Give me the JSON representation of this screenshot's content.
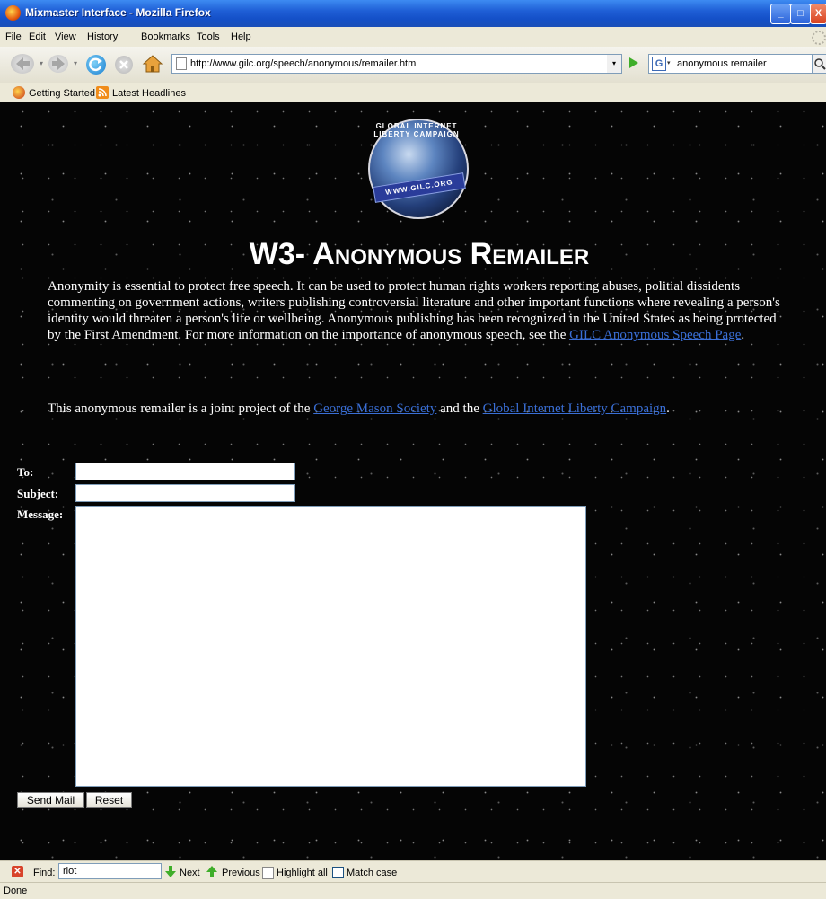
{
  "window": {
    "title": "Mixmaster Interface - Mozilla Firefox",
    "minimize": "_",
    "maximize": "□",
    "close": "X"
  },
  "menu": [
    "File",
    "Edit",
    "View",
    "History",
    "Bookmarks",
    "Tools",
    "Help"
  ],
  "nav": {
    "url": "http://www.gilc.org/speech/anonymous/remailer.html",
    "search_engine_icon": "G",
    "search_value": "anonymous remailer"
  },
  "bookmarks": [
    {
      "label": "Getting Started",
      "icon": "firefox-icon"
    },
    {
      "label": "Latest Headlines",
      "icon": "rss-icon"
    }
  ],
  "logo": {
    "ring_text": "GLOBAL INTERNET LIBERTY CAMPAIGN",
    "ribbon_text": "WWW.GILC.ORG"
  },
  "page": {
    "heading": "W3- Anonymous Remailer",
    "para1_text": "Anonymity is essential to protect free speech. It can be used to protect human rights workers reporting abuses, politial dissidents commenting on government actions, writers publishing controversial literature and other important functions where revealing a person's identity would threaten a person's life or wellbeing. Anonymous publishing has been recognized in the United States as being protected by the First Amendment. For more information on the importance of anonymous speech, see the ",
    "para1_link": "GILC Anonymous Speech Page",
    "para1_end": ".",
    "para2_text": "This anonymous remailer is a joint project of the ",
    "para2_link1": "George Mason Society",
    "para2_mid": " and the ",
    "para2_link2": "Global Internet Liberty Campaign",
    "para2_end": "."
  },
  "form": {
    "to_label": "To:",
    "subject_label": "Subject:",
    "message_label": "Message:",
    "to_value": "",
    "subject_value": "",
    "message_value": "",
    "send_label": "Send Mail",
    "reset_label": "Reset"
  },
  "findbar": {
    "label": "Find:",
    "value": "riot",
    "next": "Next",
    "previous": "Previous",
    "highlight": "Highlight all",
    "matchcase": "Match case"
  },
  "status": "Done",
  "colors": {
    "link": "#3a6fd6",
    "titlebar": "#1f5fd6",
    "chrome": "#ece9d8"
  }
}
